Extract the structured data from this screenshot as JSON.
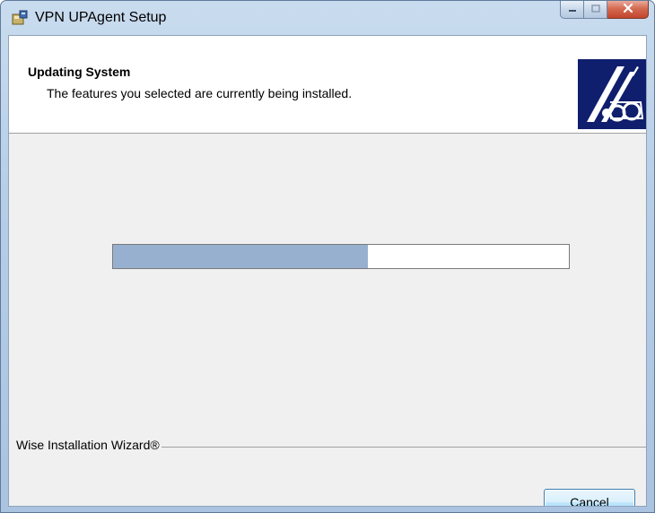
{
  "window": {
    "title": "VPN UPAgent Setup",
    "icon": "setup-installer-icon",
    "caption_buttons": [
      "minimize-icon",
      "maximize-icon",
      "close-icon"
    ]
  },
  "header": {
    "title": "Updating System",
    "subtitle": "The features you selected are currently being installed.",
    "logo": "wise-wizard-logo"
  },
  "progress": {
    "percent": 56,
    "fill_color": "#97b0cf"
  },
  "footer": {
    "label": "Wise Installation Wizard®",
    "cancel_label": "Cancel"
  },
  "colors": {
    "logo_background": "#0f1f6e",
    "window_frame": "#b6cde6",
    "close_button": "#c2452c"
  }
}
